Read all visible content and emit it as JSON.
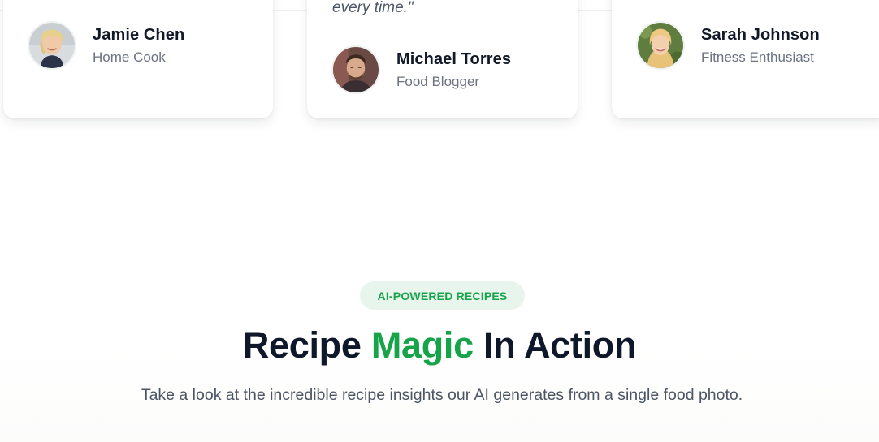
{
  "testimonials": [
    {
      "name": "Jamie Chen",
      "role": "Home Cook",
      "quote_tail": ""
    },
    {
      "name": "Michael Torres",
      "role": "Food Blogger",
      "quote_tail": "every time.\""
    },
    {
      "name": "Sarah Johnson",
      "role": "Fitness Enthusiast",
      "quote_tail": ""
    }
  ],
  "section": {
    "badge": "AI-POWERED RECIPES",
    "title_before": "Recipe",
    "title_accent": "Magic",
    "title_after": "In Action",
    "subtitle": "Take a look at the incredible recipe insights our AI generates from a single food photo."
  },
  "colors": {
    "accent": "#16a34a",
    "badge_bg": "#e8f5ec",
    "heading": "#0f172a",
    "muted": "#6b7280"
  }
}
